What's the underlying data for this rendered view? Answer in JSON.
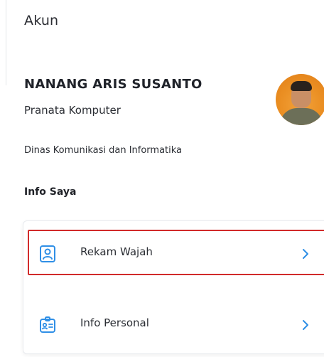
{
  "header": {
    "title": "Akun"
  },
  "profile": {
    "name": "NANANG ARIS SUSANTO",
    "role": "Pranata Komputer",
    "department": "Dinas Komunikasi dan Informatika"
  },
  "section": {
    "title": "Info Saya"
  },
  "menu": {
    "items": [
      {
        "label": "Rekam Wajah",
        "icon": "face-id-icon"
      },
      {
        "label": "Info Personal",
        "icon": "id-badge-icon"
      }
    ]
  },
  "colors": {
    "accent": "#2f8fe6",
    "highlight": "#d12a2a",
    "avatar_bg": "#ea8e22"
  }
}
